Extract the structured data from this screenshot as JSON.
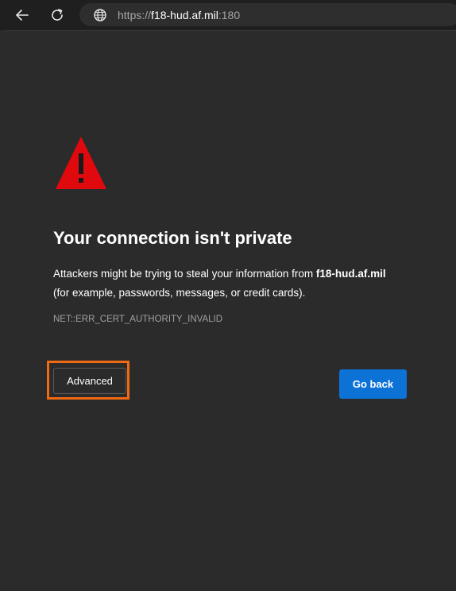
{
  "toolbar": {
    "back_icon": "back-arrow-icon",
    "reload_icon": "reload-icon",
    "site_icon": "globe-icon",
    "url_scheme": "https://",
    "url_host": "f18-hud.af.mil",
    "url_port": ":180"
  },
  "page": {
    "warning_icon": "warning-triangle-icon",
    "warning_color": "#e0090e",
    "headline": "Your connection isn't private",
    "message_prefix": "Attackers might be trying to steal your information from ",
    "message_host": "f18-hud.af.mil",
    "message_suffix": "(for example, passwords, messages, or credit cards).",
    "error_code": "NET::ERR_CERT_AUTHORITY_INVALID",
    "advanced_label": "Advanced",
    "go_back_label": "Go back",
    "go_back_color": "#0c72d6",
    "highlight_color": "#f06a12"
  }
}
